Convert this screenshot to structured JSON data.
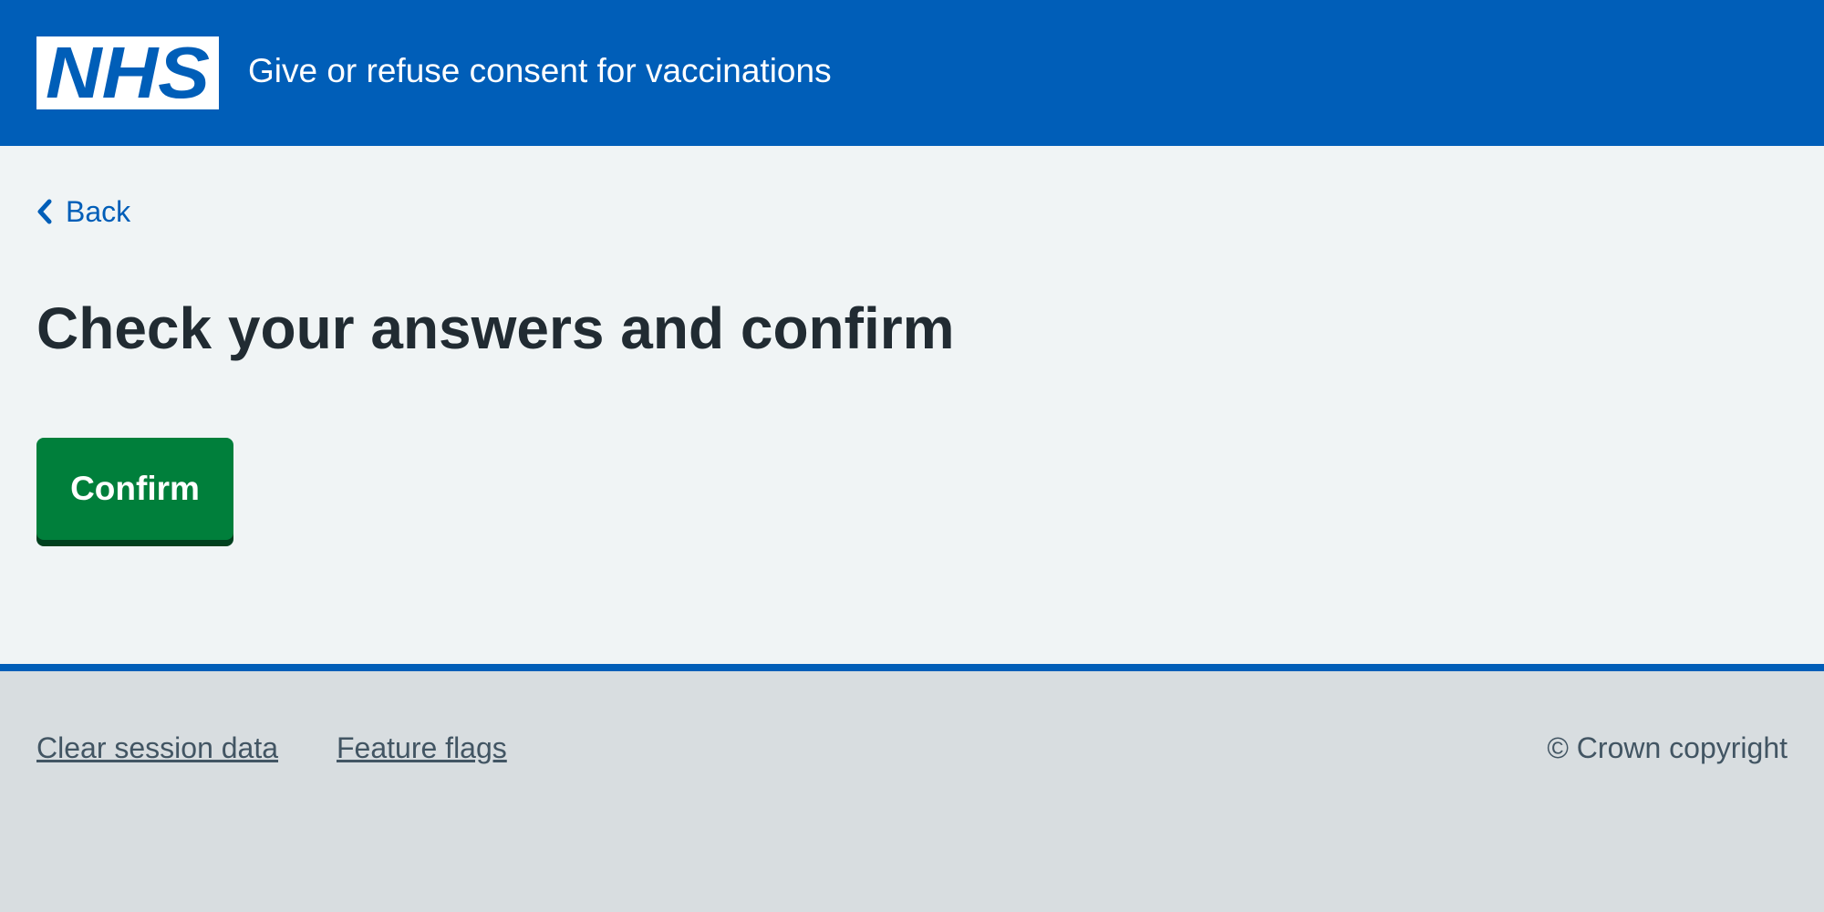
{
  "header": {
    "logo_text": "NHS",
    "service_name": "Give or refuse consent for vaccinations"
  },
  "navigation": {
    "back_label": "Back"
  },
  "main": {
    "title": "Check your answers and confirm",
    "confirm_label": "Confirm"
  },
  "footer": {
    "links": [
      {
        "label": "Clear session data"
      },
      {
        "label": "Feature flags"
      }
    ],
    "copyright": "© Crown copyright"
  },
  "colors": {
    "nhs_blue": "#005eb8",
    "page_background": "#f0f4f5",
    "text_dark": "#212b32",
    "button_green": "#007f3b",
    "button_shadow": "#00401e",
    "footer_background": "#d8dde0",
    "footer_text": "#425563"
  },
  "icons": {
    "logo": "nhs-logo",
    "back": "chevron-left-icon"
  }
}
